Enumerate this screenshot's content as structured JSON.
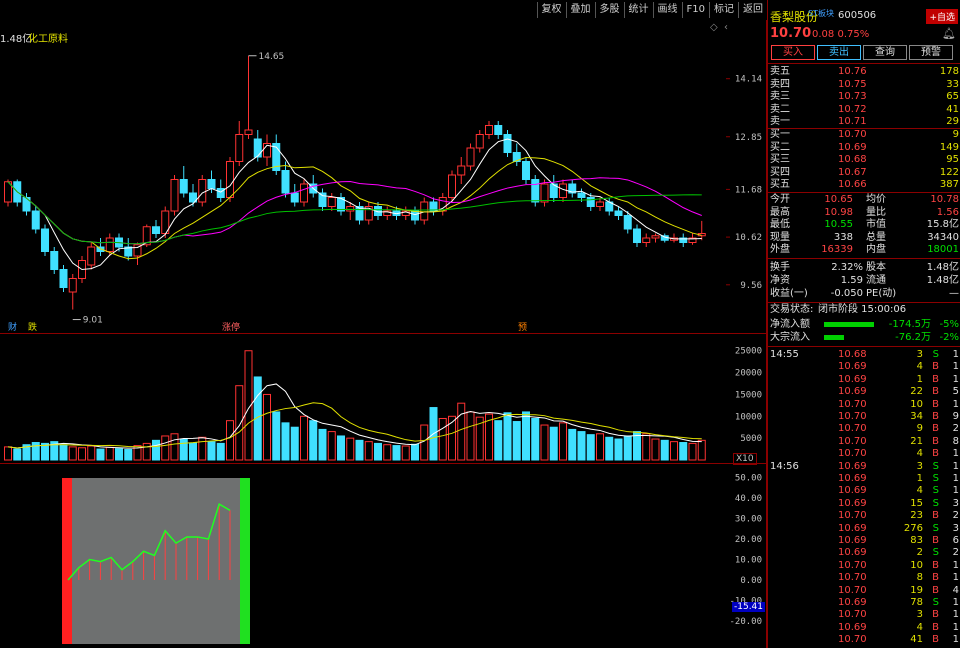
{
  "toolbar": {
    "buttons": [
      "复权",
      "叠加",
      "多股",
      "统计",
      "画线",
      "F10",
      "标记",
      "返回"
    ]
  },
  "main_chart": {
    "label_value": "1.48亿",
    "label_sector": "化工原料",
    "y_ticks": [
      "14.14",
      "12.85",
      "11.68",
      "10.62",
      "9.56"
    ],
    "high_label": "14.65",
    "low_label": "9.01",
    "markers": [
      "财",
      "跌",
      "涨停",
      "预"
    ]
  },
  "volume_chart": {
    "y_ticks": [
      "25000",
      "20000",
      "15000",
      "10000",
      "5000"
    ],
    "unit": "X10"
  },
  "indicator_chart": {
    "y_ticks": [
      "50.00",
      "40.00",
      "30.00",
      "20.00",
      "10.00",
      "0.00",
      "-10.00",
      "-20.00"
    ],
    "current_value": "-15.41"
  },
  "quote": {
    "name": "香梨股份",
    "badge": "ST板块",
    "code": "600506",
    "add_button": "+自选",
    "price": "10.70",
    "change": "0.08",
    "change_pct": "0.75%",
    "trade_buttons": [
      "买入",
      "卖出",
      "查询",
      "预警"
    ],
    "sell_levels": [
      {
        "label": "卖五",
        "price": "10.76",
        "vol": "178"
      },
      {
        "label": "卖四",
        "price": "10.75",
        "vol": "33"
      },
      {
        "label": "卖三",
        "price": "10.73",
        "vol": "65"
      },
      {
        "label": "卖二",
        "price": "10.72",
        "vol": "41"
      },
      {
        "label": "卖一",
        "price": "10.71",
        "vol": "29"
      }
    ],
    "buy_levels": [
      {
        "label": "买一",
        "price": "10.70",
        "vol": "9"
      },
      {
        "label": "买二",
        "price": "10.69",
        "vol": "149"
      },
      {
        "label": "买三",
        "price": "10.68",
        "vol": "95"
      },
      {
        "label": "买四",
        "price": "10.67",
        "vol": "122"
      },
      {
        "label": "买五",
        "price": "10.66",
        "vol": "387"
      }
    ],
    "stats": [
      {
        "l1": "今开",
        "v1": "10.65",
        "c1": "red",
        "l2": "均价",
        "v2": "10.78",
        "c2": "red"
      },
      {
        "l1": "最高",
        "v1": "10.98",
        "c1": "red",
        "l2": "量比",
        "v2": "1.56",
        "c2": "red"
      },
      {
        "l1": "最低",
        "v1": "10.55",
        "c1": "green",
        "l2": "市值",
        "v2": "15.8亿",
        "c2": "wht"
      },
      {
        "l1": "现量",
        "v1": "338",
        "c1": "wht",
        "l2": "总量",
        "v2": "34340",
        "c2": "wht"
      },
      {
        "l1": "外盘",
        "v1": "16339",
        "c1": "red",
        "l2": "内盘",
        "v2": "18001",
        "c2": "green"
      }
    ],
    "stats2": [
      {
        "l1": "换手",
        "v1": "2.32%",
        "l2": "股本",
        "v2": "1.48亿"
      },
      {
        "l1": "净资",
        "v1": "1.59",
        "l2": "流通",
        "v2": "1.48亿"
      },
      {
        "l1": "收益(一)",
        "v1": "-0.050",
        "l2": "PE(动)",
        "v2": "—"
      }
    ],
    "status_label": "交易状态:",
    "status_value": "闭市阶段 15:00:06",
    "flows": [
      {
        "label": "净流入额",
        "value": "-174.5万",
        "pct": "-5%",
        "fill": 0.5
      },
      {
        "label": "大宗流入",
        "value": "-76.2万",
        "pct": "-2%",
        "fill": 0.2
      }
    ],
    "ticks": [
      {
        "time": "14:55",
        "price": "10.68",
        "vol": "3",
        "side": "S",
        "n": "1"
      },
      {
        "time": "",
        "price": "10.69",
        "vol": "4",
        "side": "B",
        "n": "1"
      },
      {
        "time": "",
        "price": "10.69",
        "vol": "1",
        "side": "B",
        "n": "1"
      },
      {
        "time": "",
        "price": "10.69",
        "vol": "22",
        "side": "B",
        "n": "5"
      },
      {
        "time": "",
        "price": "10.70",
        "vol": "10",
        "side": "B",
        "n": "1"
      },
      {
        "time": "",
        "price": "10.70",
        "vol": "34",
        "side": "B",
        "n": "9"
      },
      {
        "time": "",
        "price": "10.70",
        "vol": "9",
        "side": "B",
        "n": "2"
      },
      {
        "time": "",
        "price": "10.70",
        "vol": "21",
        "side": "B",
        "n": "8"
      },
      {
        "time": "",
        "price": "10.70",
        "vol": "4",
        "side": "B",
        "n": "1"
      },
      {
        "time": "14:56",
        "price": "10.69",
        "vol": "3",
        "side": "S",
        "n": "1"
      },
      {
        "time": "",
        "price": "10.69",
        "vol": "1",
        "side": "S",
        "n": "1"
      },
      {
        "time": "",
        "price": "10.69",
        "vol": "4",
        "side": "S",
        "n": "1"
      },
      {
        "time": "",
        "price": "10.69",
        "vol": "15",
        "side": "S",
        "n": "3"
      },
      {
        "time": "",
        "price": "10.70",
        "vol": "23",
        "side": "B",
        "n": "2"
      },
      {
        "time": "",
        "price": "10.69",
        "vol": "276",
        "side": "S",
        "n": "3"
      },
      {
        "time": "",
        "price": "10.69",
        "vol": "83",
        "side": "B",
        "n": "6"
      },
      {
        "time": "",
        "price": "10.69",
        "vol": "2",
        "side": "S",
        "n": "2"
      },
      {
        "time": "",
        "price": "10.70",
        "vol": "10",
        "side": "B",
        "n": "1"
      },
      {
        "time": "",
        "price": "10.70",
        "vol": "8",
        "side": "B",
        "n": "1"
      },
      {
        "time": "",
        "price": "10.70",
        "vol": "19",
        "side": "B",
        "n": "4"
      },
      {
        "time": "",
        "price": "10.69",
        "vol": "78",
        "side": "S",
        "n": "1"
      },
      {
        "time": "",
        "price": "10.70",
        "vol": "3",
        "side": "B",
        "n": "1"
      },
      {
        "time": "",
        "price": "10.69",
        "vol": "4",
        "side": "B",
        "n": "1"
      },
      {
        "time": "",
        "price": "10.70",
        "vol": "41",
        "side": "B",
        "n": "1"
      }
    ]
  },
  "chart_data": {
    "type": "candlestick",
    "ylim": [
      9.0,
      15.0
    ],
    "candles": [
      [
        11.4,
        11.9,
        11.3,
        11.85
      ],
      [
        11.85,
        11.9,
        11.3,
        11.4
      ],
      [
        11.5,
        11.6,
        11.1,
        11.2
      ],
      [
        11.2,
        11.3,
        10.7,
        10.8
      ],
      [
        10.8,
        10.9,
        10.2,
        10.3
      ],
      [
        10.3,
        10.4,
        9.8,
        9.9
      ],
      [
        9.9,
        10.0,
        9.4,
        9.5
      ],
      [
        9.4,
        9.8,
        9.01,
        9.7
      ],
      [
        9.7,
        10.2,
        9.6,
        10.1
      ],
      [
        10.0,
        10.5,
        9.9,
        10.4
      ],
      [
        10.4,
        10.6,
        10.2,
        10.3
      ],
      [
        10.3,
        10.7,
        10.2,
        10.6
      ],
      [
        10.6,
        10.7,
        10.3,
        10.4
      ],
      [
        10.4,
        10.6,
        10.1,
        10.2
      ],
      [
        10.2,
        10.5,
        10.0,
        10.45
      ],
      [
        10.45,
        10.9,
        10.4,
        10.85
      ],
      [
        10.85,
        11.0,
        10.6,
        10.7
      ],
      [
        10.7,
        11.3,
        10.6,
        11.2
      ],
      [
        11.2,
        12.0,
        11.1,
        11.9
      ],
      [
        11.9,
        12.2,
        11.5,
        11.6
      ],
      [
        11.6,
        11.8,
        11.3,
        11.4
      ],
      [
        11.4,
        12.0,
        11.3,
        11.9
      ],
      [
        11.9,
        12.1,
        11.6,
        11.7
      ],
      [
        11.7,
        11.9,
        11.4,
        11.5
      ],
      [
        11.5,
        12.4,
        11.4,
        12.3
      ],
      [
        12.3,
        13.2,
        12.2,
        12.9
      ],
      [
        12.9,
        14.65,
        12.8,
        13.0
      ],
      [
        12.8,
        13.0,
        12.3,
        12.4
      ],
      [
        12.4,
        12.9,
        12.2,
        12.7
      ],
      [
        12.7,
        12.9,
        12.0,
        12.1
      ],
      [
        12.1,
        12.3,
        11.5,
        11.6
      ],
      [
        11.6,
        11.8,
        11.3,
        11.4
      ],
      [
        11.4,
        11.9,
        11.3,
        11.8
      ],
      [
        11.8,
        12.0,
        11.5,
        11.6
      ],
      [
        11.6,
        11.7,
        11.2,
        11.3
      ],
      [
        11.3,
        11.6,
        11.2,
        11.5
      ],
      [
        11.5,
        11.6,
        11.1,
        11.2
      ],
      [
        11.2,
        11.4,
        11.0,
        11.3
      ],
      [
        11.3,
        11.4,
        10.9,
        11.0
      ],
      [
        11.0,
        11.4,
        10.9,
        11.3
      ],
      [
        11.3,
        11.4,
        11.0,
        11.1
      ],
      [
        11.1,
        11.3,
        11.0,
        11.2
      ],
      [
        11.2,
        11.3,
        11.0,
        11.1
      ],
      [
        11.1,
        11.3,
        11.0,
        11.2
      ],
      [
        11.2,
        11.3,
        10.9,
        11.0
      ],
      [
        11.0,
        11.5,
        10.9,
        11.4
      ],
      [
        11.4,
        11.5,
        11.1,
        11.2
      ],
      [
        11.2,
        11.6,
        11.1,
        11.5
      ],
      [
        11.5,
        12.1,
        11.4,
        12.0
      ],
      [
        12.0,
        12.4,
        11.8,
        12.2
      ],
      [
        12.2,
        12.7,
        12.1,
        12.6
      ],
      [
        12.6,
        13.0,
        12.5,
        12.9
      ],
      [
        12.9,
        13.2,
        12.8,
        13.1
      ],
      [
        13.1,
        13.2,
        12.8,
        12.9
      ],
      [
        12.9,
        13.0,
        12.4,
        12.5
      ],
      [
        12.5,
        12.7,
        12.2,
        12.3
      ],
      [
        12.3,
        12.4,
        11.8,
        11.9
      ],
      [
        11.9,
        12.0,
        11.3,
        11.4
      ],
      [
        11.4,
        11.9,
        11.3,
        11.8
      ],
      [
        11.8,
        12.0,
        11.4,
        11.5
      ],
      [
        11.5,
        11.9,
        11.4,
        11.8
      ],
      [
        11.8,
        11.9,
        11.5,
        11.6
      ],
      [
        11.6,
        11.7,
        11.4,
        11.5
      ],
      [
        11.5,
        11.6,
        11.2,
        11.3
      ],
      [
        11.3,
        11.5,
        11.2,
        11.4
      ],
      [
        11.4,
        11.5,
        11.1,
        11.2
      ],
      [
        11.2,
        11.3,
        11.0,
        11.1
      ],
      [
        11.1,
        11.2,
        10.7,
        10.8
      ],
      [
        10.8,
        10.9,
        10.4,
        10.5
      ],
      [
        10.5,
        10.7,
        10.4,
        10.6
      ],
      [
        10.6,
        10.7,
        10.5,
        10.65
      ],
      [
        10.65,
        10.7,
        10.5,
        10.55
      ],
      [
        10.55,
        10.7,
        10.5,
        10.6
      ],
      [
        10.6,
        10.7,
        10.4,
        10.5
      ],
      [
        10.5,
        10.7,
        10.45,
        10.6
      ],
      [
        10.65,
        10.98,
        10.55,
        10.7
      ]
    ],
    "volumes": [
      3000,
      2500,
      3500,
      4000,
      3800,
      4200,
      3500,
      3000,
      2800,
      3200,
      2500,
      2900,
      2600,
      2400,
      3300,
      3800,
      4500,
      5500,
      6000,
      4800,
      3900,
      5200,
      4200,
      3800,
      9000,
      17000,
      25000,
      19000,
      15000,
      11000,
      8500,
      7500,
      10000,
      9000,
      7000,
      6500,
      5500,
      5000,
      4500,
      4200,
      3800,
      3500,
      3300,
      3200,
      3600,
      8000,
      12000,
      9500,
      10000,
      13000,
      11000,
      9800,
      10500,
      9000,
      10800,
      8800,
      11000,
      9500,
      8000,
      7500,
      8500,
      7000,
      6500,
      5800,
      6000,
      5200,
      4800,
      5500,
      6500,
      6000,
      4800,
      4500,
      4200,
      4000,
      3800,
      4500
    ],
    "indicator": {
      "highlight_start_index": 35,
      "highlight_end_index": 48,
      "values": [
        0,
        6,
        10,
        9,
        11,
        5,
        9,
        14,
        12,
        24,
        18,
        21,
        21,
        20,
        37,
        34
      ]
    }
  }
}
